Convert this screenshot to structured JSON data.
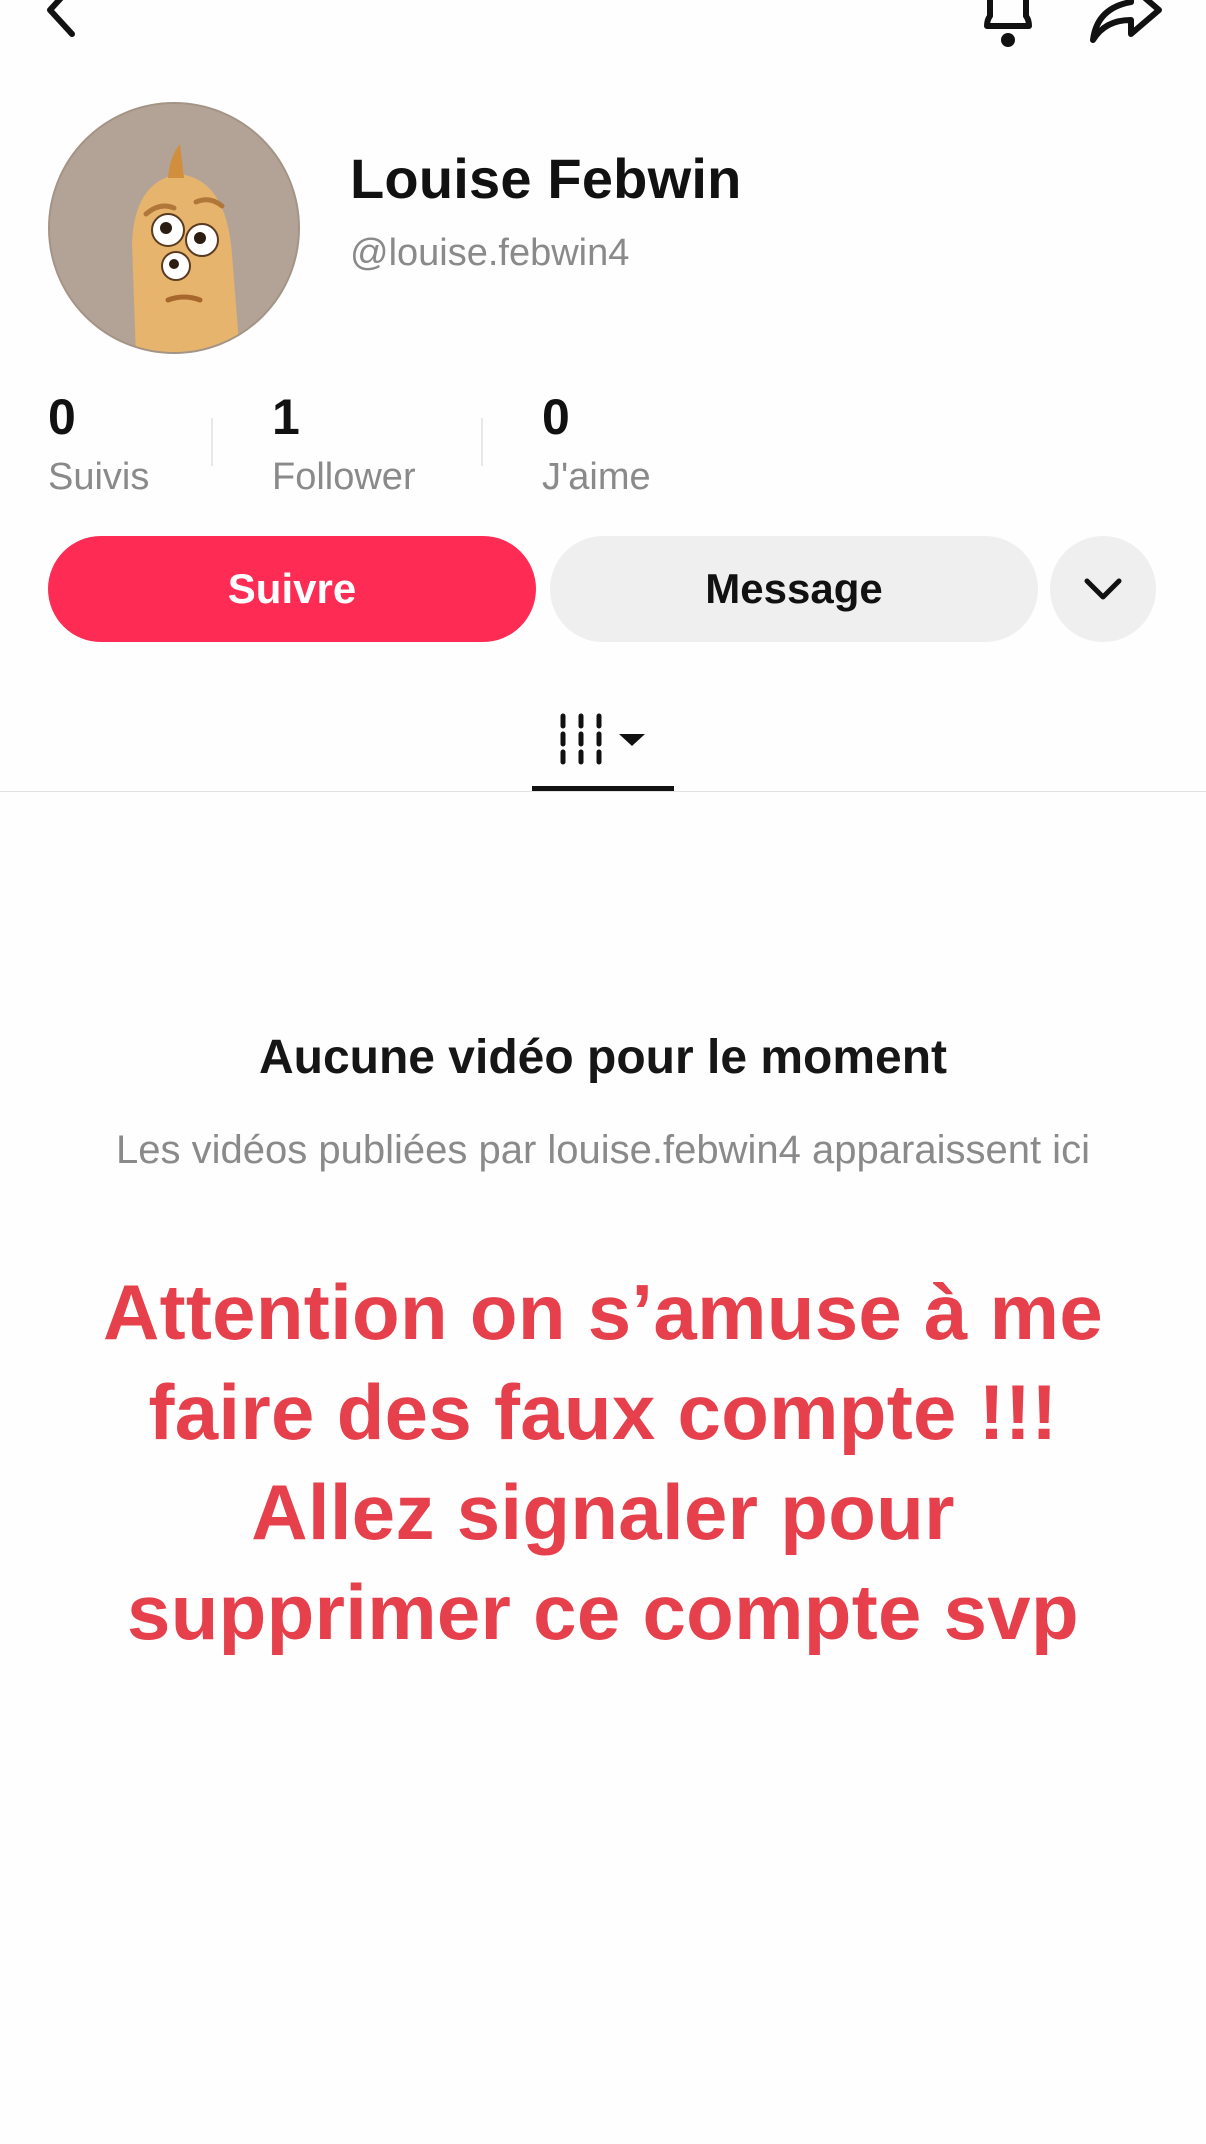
{
  "profile": {
    "display_name": "Louise Febwin",
    "handle": "@louise.febwin4"
  },
  "stats": [
    {
      "count": "0",
      "label": "Suivis"
    },
    {
      "count": "1",
      "label": "Follower"
    },
    {
      "count": "0",
      "label": "J'aime"
    }
  ],
  "actions": {
    "follow_label": "Suivre",
    "message_label": "Message"
  },
  "icons": {
    "back": "chevron-left-icon",
    "notifications": "bell-icon",
    "share": "share-arrow-icon",
    "more": "chevron-down-icon",
    "videos_tab": "grid-columns-icon"
  },
  "empty_state": {
    "title": "Aucune vidéo pour le moment",
    "description": "Les vidéos publiées par louise.febwin4 apparaissent ici"
  },
  "overlay_text": {
    "line1": "Attention on s’amuse à me",
    "line2": "faire des faux compte !!!",
    "line3": "Allez signaler pour",
    "line4": "supprimer ce compte svp"
  },
  "colors": {
    "follow_button": "#fe2c55",
    "warning_text": "#e5404b",
    "secondary_text": "#8a8a8a",
    "avatar_bg": "#b0a094"
  }
}
